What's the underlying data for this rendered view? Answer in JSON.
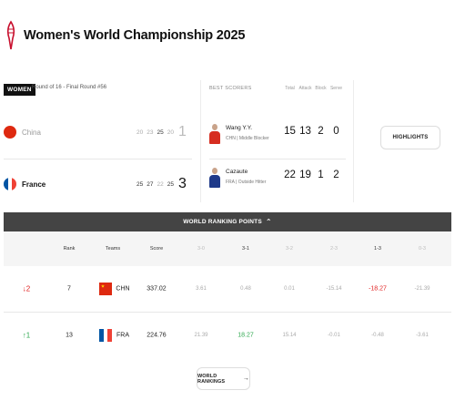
{
  "header": {
    "title": "Women's World Championship 2025"
  },
  "match": {
    "category_badge": "WOMEN",
    "round": "Round of 16 - Final Round #56",
    "teams": [
      {
        "name": "China",
        "sets": [
          "20",
          "23",
          "25",
          "20"
        ],
        "total": "1",
        "result": "loss"
      },
      {
        "name": "France",
        "sets": [
          "25",
          "27",
          "22",
          "25"
        ],
        "total": "3",
        "result": "win"
      }
    ]
  },
  "best_scorers": {
    "label": "BEST SCORERS",
    "headers": [
      "Total",
      "Attack",
      "Block",
      "Serve"
    ],
    "players": [
      {
        "name": "Wang Y.Y.",
        "team_position": "CHN | Middle Blocker",
        "stats": [
          "15",
          "13",
          "2",
          "0"
        ],
        "jersey_color": "#d62d20"
      },
      {
        "name": "Cazaute",
        "team_position": "FRA | Outside Hitter",
        "stats": [
          "22",
          "19",
          "1",
          "2"
        ],
        "jersey_color": "#1f3a8a"
      }
    ]
  },
  "highlights_button": "HIGHLIGHTS",
  "ranking_points": {
    "bar_label": "WORLD RANKING POINTS",
    "headers": [
      "Rank",
      "Teams",
      "Score",
      "3-0",
      "3-1",
      "3-2",
      "2-3",
      "1-3",
      "0-3"
    ],
    "rows": [
      {
        "movement": "↓2",
        "movement_dir": "down",
        "rank": "7",
        "team": "CHN",
        "score": "337.02",
        "results": [
          "3.61",
          "0.48",
          "0.01",
          "-15.14",
          "-18.27",
          "-21.39"
        ]
      },
      {
        "movement": "↑1",
        "movement_dir": "up",
        "rank": "13",
        "team": "FRA",
        "score": "224.76",
        "results": [
          "21.39",
          "18.27",
          "15.14",
          "-0.01",
          "-0.48",
          "-3.61"
        ]
      }
    ]
  },
  "world_rankings_button": "WORLD RANKINGS",
  "colors": {
    "bar_bg": "#444444",
    "positive": "#2fa84f",
    "negative": "#e02020",
    "china_red": "#de2910",
    "france_blue": "#0055a4",
    "france_red": "#ef4135"
  }
}
